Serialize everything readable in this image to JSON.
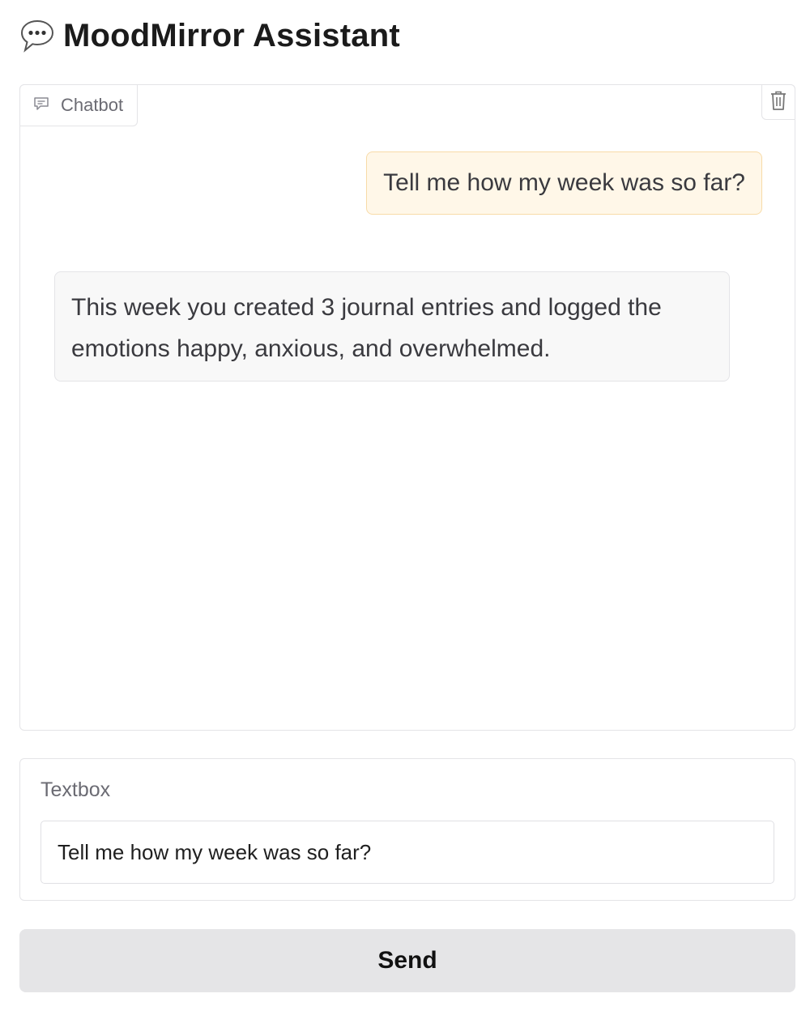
{
  "app": {
    "title_icon": "speech-balloon-icon",
    "title": "MoodMirror Assistant"
  },
  "chatbot": {
    "label": "Chatbot",
    "label_icon": "chat-icon",
    "clear_icon": "trash-icon",
    "messages": [
      {
        "role": "user",
        "text": "Tell me how my week was so far?"
      },
      {
        "role": "assistant",
        "text": "This week you created 3 journal entries and logged the emotions happy, anxious, and overwhelmed."
      }
    ]
  },
  "textbox": {
    "label": "Textbox",
    "value": "Tell me how my week was so far?"
  },
  "send_button": {
    "label": "Send"
  },
  "colors": {
    "user_bubble_bg": "#fff7e8",
    "user_bubble_border": "#f8dba8",
    "bot_bubble_bg": "#f8f8f8",
    "button_bg": "#e5e5e7"
  }
}
